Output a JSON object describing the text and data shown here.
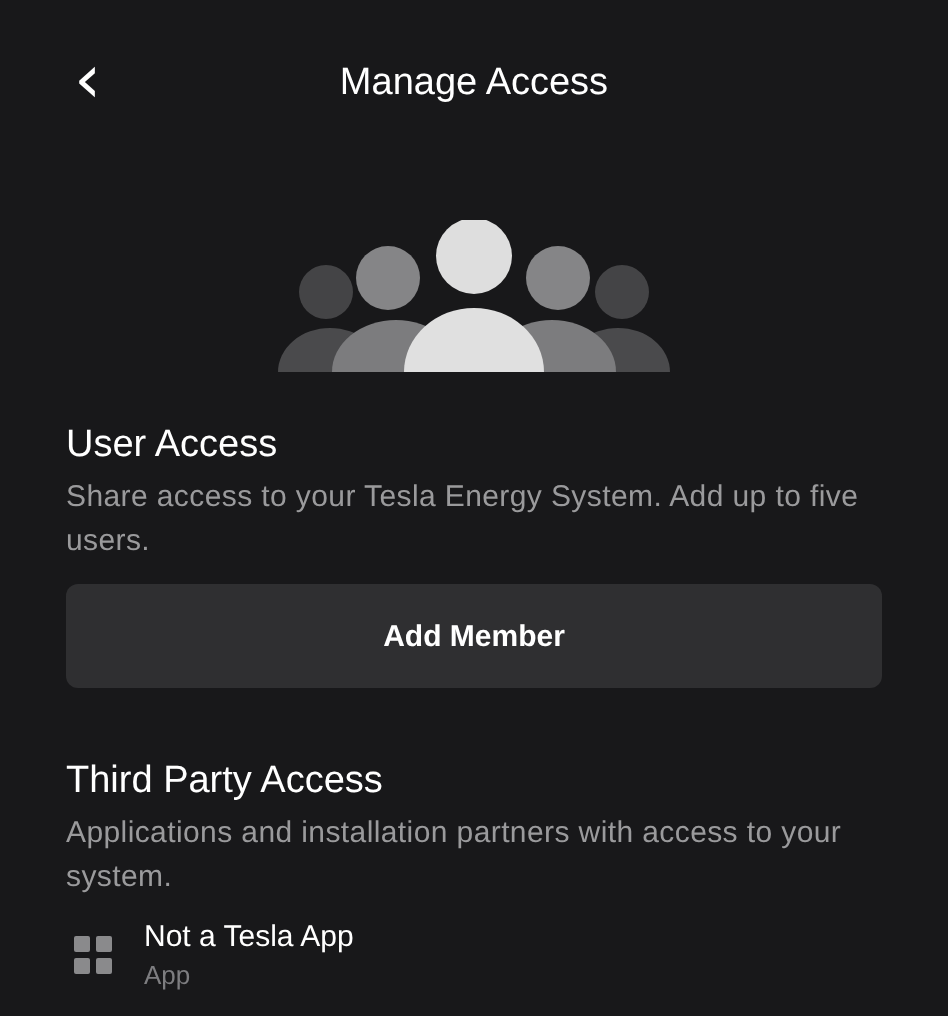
{
  "header": {
    "back": "‹",
    "title": "Manage Access"
  },
  "user_access": {
    "title": "User Access",
    "description": "Share access to your Tesla Energy System. Add up to five users.",
    "button": "Add Member"
  },
  "third_party": {
    "title": "Third Party Access",
    "description": "Applications and installation partners with access to your system.",
    "apps": [
      {
        "name": "Not a Tesla App",
        "type": "App"
      }
    ]
  }
}
